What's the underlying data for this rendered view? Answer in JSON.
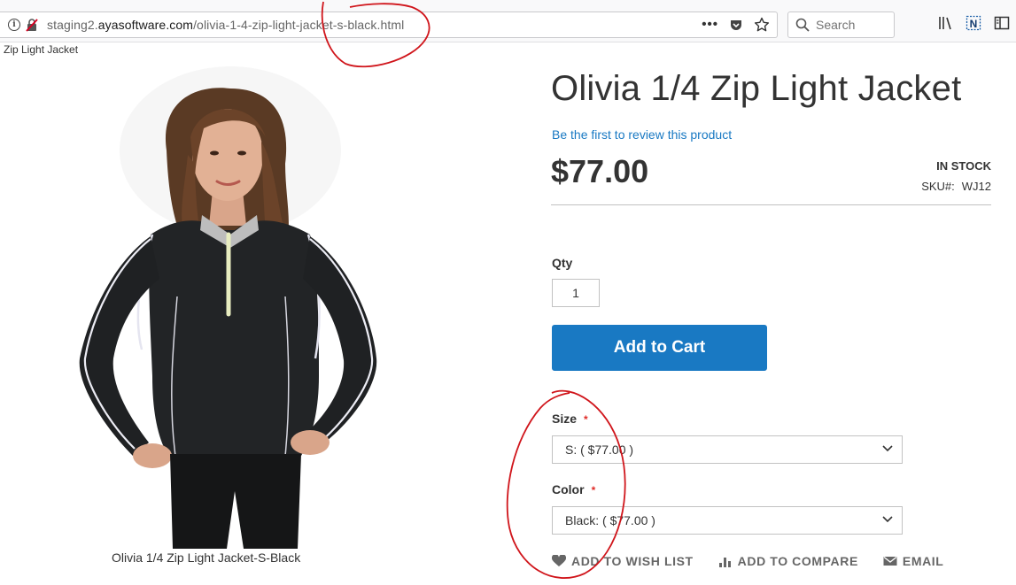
{
  "browser": {
    "url_prefix": "staging2.",
    "url_domain": "ayasoftware.com",
    "url_path": "/olivia-1-4-zip-light-jacket-s-black.html",
    "search_placeholder": "Search",
    "icons": [
      "info-icon",
      "insecure-lock-icon",
      "page-actions-icon",
      "pocket-icon",
      "bookmark-star-icon",
      "search-icon",
      "library-icon",
      "extension-n-icon",
      "sidebar-icon"
    ]
  },
  "breadcrumb": "Zip Light Jacket",
  "product": {
    "title": "Olivia 1/4 Zip Light Jacket",
    "review_link": "Be the first to review this product",
    "price": "$77.00",
    "stock": "IN STOCK",
    "sku_label": "SKU#:",
    "sku_value": "WJ12",
    "image_caption": "Olivia 1/4 Zip Light Jacket-S-Black"
  },
  "form": {
    "qty_label": "Qty",
    "qty_value": "1",
    "add_to_cart": "Add to Cart",
    "size_label": "Size",
    "size_value": "S: ( $77.00 )",
    "color_label": "Color",
    "color_value": "Black: ( $77.00 )",
    "required_mark": "*"
  },
  "actions": {
    "wishlist": "ADD TO WISH LIST",
    "compare": "ADD TO COMPARE",
    "email": "EMAIL"
  },
  "colors": {
    "accent": "#1979c3",
    "required": "#e02b27",
    "annotation": "#d0151b"
  }
}
